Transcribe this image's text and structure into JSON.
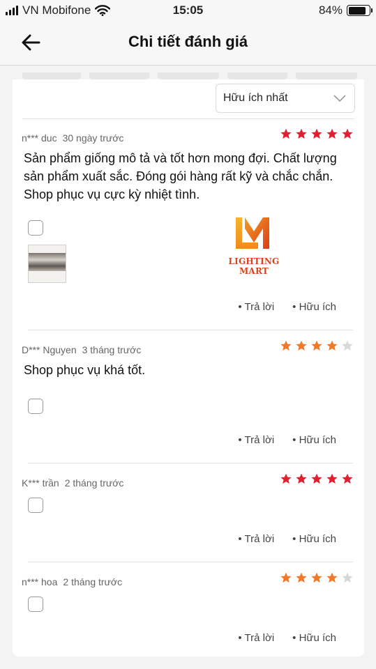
{
  "status_bar": {
    "carrier": "VN Mobifone",
    "time": "15:05",
    "battery": "84%",
    "battery_level": 0.84
  },
  "nav": {
    "title": "Chi tiết đánh giá",
    "back_icon": "arrow-left-icon"
  },
  "sort": {
    "selected": "Hữu ích nhất"
  },
  "colors": {
    "star_red": "#e0202f",
    "star_orange": "#f07a2a",
    "star_empty": "#d8d8d8"
  },
  "reviews": [
    {
      "user": "n*** duc",
      "time": "30 ngày trước",
      "rating": 5,
      "star_color": "#e0202f",
      "text": "Sản phẩm giống mô tả và tốt hơn mong đợi. Chất lượng sản phẩm xuất sắc. Đóng gói hàng rất kỹ và chắc chắn. Shop phục vụ cực kỳ nhiệt tình.",
      "has_photo": true,
      "logo_text": "LIGHTING MART",
      "reply": "Trả lời",
      "helpful": "Hữu ích"
    },
    {
      "user": "D*** Nguyen",
      "time": "3 tháng trước",
      "rating": 4,
      "star_color": "#f07a2a",
      "text": "Shop phục vụ khá tốt.",
      "reply": "Trả lời",
      "helpful": "Hữu ích"
    },
    {
      "user": "K*** trần",
      "time": "2 tháng trước",
      "rating": 5,
      "star_color": "#e0202f",
      "text": "",
      "reply": "Trả lời",
      "helpful": "Hữu ích"
    },
    {
      "user": "n*** hoa",
      "time": "2 tháng trước",
      "rating": 4,
      "star_color": "#f07a2a",
      "text": "",
      "reply": "Trả lời",
      "helpful": "Hữu ích"
    }
  ]
}
